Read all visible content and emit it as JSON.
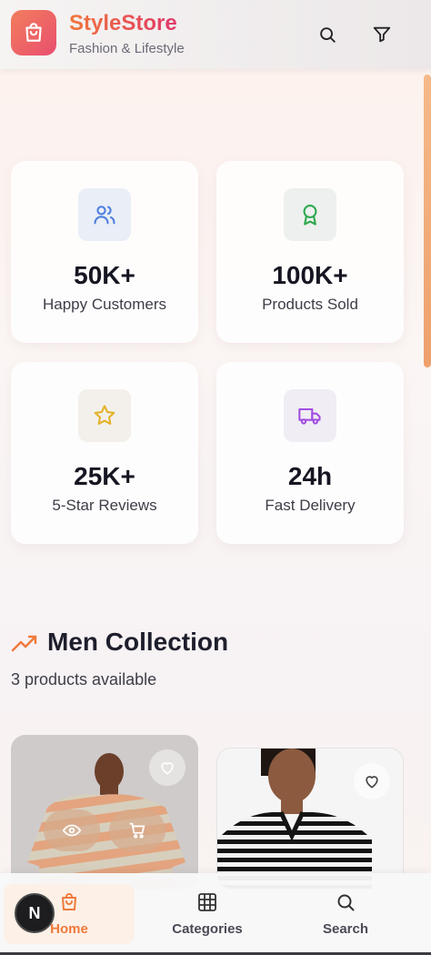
{
  "header": {
    "brand_name": "StyleStore",
    "brand_tagline": "Fashion & Lifestyle",
    "icons": [
      "shopping-bag-icon",
      "search-icon",
      "filter-icon"
    ]
  },
  "stats": [
    {
      "value": "50K+",
      "label": "Happy Customers",
      "icon": "users-icon",
      "color": "#4f7fe0"
    },
    {
      "value": "100K+",
      "label": "Products Sold",
      "icon": "award-icon",
      "color": "#2fa84f"
    },
    {
      "value": "25K+",
      "label": "5-Star Reviews",
      "icon": "star-icon",
      "color": "#e4b22a"
    },
    {
      "value": "24h",
      "label": "Fast Delivery",
      "icon": "truck-icon",
      "color": "#a24fe0"
    }
  ],
  "section": {
    "title": "Men Collection",
    "subtitle": "3 products available",
    "icon": "trending-up-icon",
    "accent": "#f0783c"
  },
  "products": [
    {
      "icon": "heart-icon",
      "actions": [
        "eye-icon",
        "cart-icon"
      ]
    },
    {
      "icon": "heart-icon"
    }
  ],
  "nav": {
    "items": [
      {
        "label": "Home",
        "icon": "shopping-bag-icon",
        "active": true
      },
      {
        "label": "Categories",
        "icon": "grid-icon"
      },
      {
        "label": "Search",
        "icon": "search-icon"
      }
    ],
    "avatar_initial": "N"
  },
  "colors": {
    "brand_orange": "#f0783c",
    "brand_pink": "#e0386a",
    "text_dark": "#1e1e2c"
  }
}
